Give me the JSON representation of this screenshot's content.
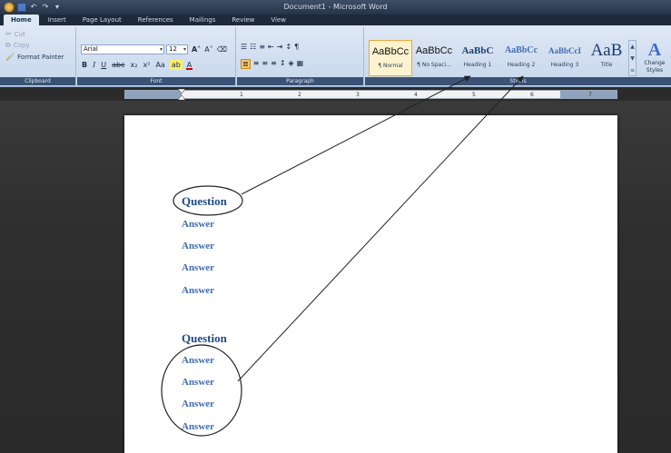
{
  "window": {
    "title": "Document1 - Microsoft Word"
  },
  "qat": {
    "undo": "↶",
    "redo": "↷",
    "more": "▾"
  },
  "tabs": [
    "Home",
    "Insert",
    "Page Layout",
    "References",
    "Mailings",
    "Review",
    "View"
  ],
  "clipboard": {
    "cut": "Cut",
    "copy": "Copy",
    "format_painter": "Format Painter",
    "group_label": "Clipboard"
  },
  "font": {
    "name": "Arial",
    "size": "12",
    "group_label": "Font",
    "grow": "A˄",
    "shrink": "A˅",
    "clear": "⌫",
    "bold": "B",
    "italic": "I",
    "underline": "U",
    "strike": "abc",
    "subscript": "x₂",
    "superscript": "x²",
    "case": "Aa",
    "highlight": "ab",
    "font_color": "A"
  },
  "paragraph": {
    "group_label": "Paragraph",
    "row1": [
      "☰",
      "☷",
      "≡",
      "⇤",
      "⇥",
      "↕",
      "¶"
    ],
    "row2": [
      "≣",
      "≡",
      "≡",
      "≡",
      "↕",
      "◈",
      "▦"
    ]
  },
  "styles": {
    "group_label": "Styles",
    "items": [
      {
        "sample": "AaBbCc",
        "name": "¶ Normal"
      },
      {
        "sample": "AaBbCc",
        "name": "¶ No Spaci..."
      },
      {
        "sample": "AaBbC",
        "name": "Heading 1"
      },
      {
        "sample": "AaBbCc",
        "name": "Heading 2"
      },
      {
        "sample": "AaBbCcI",
        "name": "Heading 3"
      },
      {
        "sample": "AaB",
        "name": "Title"
      }
    ],
    "change_styles": "Change Styles"
  },
  "ruler": {
    "numbers": [
      "1",
      "2",
      "3",
      "4",
      "5",
      "6",
      "7"
    ]
  },
  "document": {
    "paragraphs": [
      {
        "style": "q",
        "text": "Question"
      },
      {
        "style": "a",
        "text": "Answer"
      },
      {
        "style": "a",
        "text": "Answer"
      },
      {
        "style": "a",
        "text": "Answer"
      },
      {
        "style": "a",
        "text": "Answer"
      },
      {
        "style": "q",
        "text": "Question"
      },
      {
        "style": "a",
        "text": "Answer"
      },
      {
        "style": "a",
        "text": "Answer"
      },
      {
        "style": "a",
        "text": "Answer"
      },
      {
        "style": "a",
        "text": "Answer"
      }
    ]
  },
  "colors": {
    "heading1": "#1f4a86",
    "heading2": "#3f6cb1",
    "ribbon": "#dfe8f5",
    "annotation": "#222222"
  }
}
